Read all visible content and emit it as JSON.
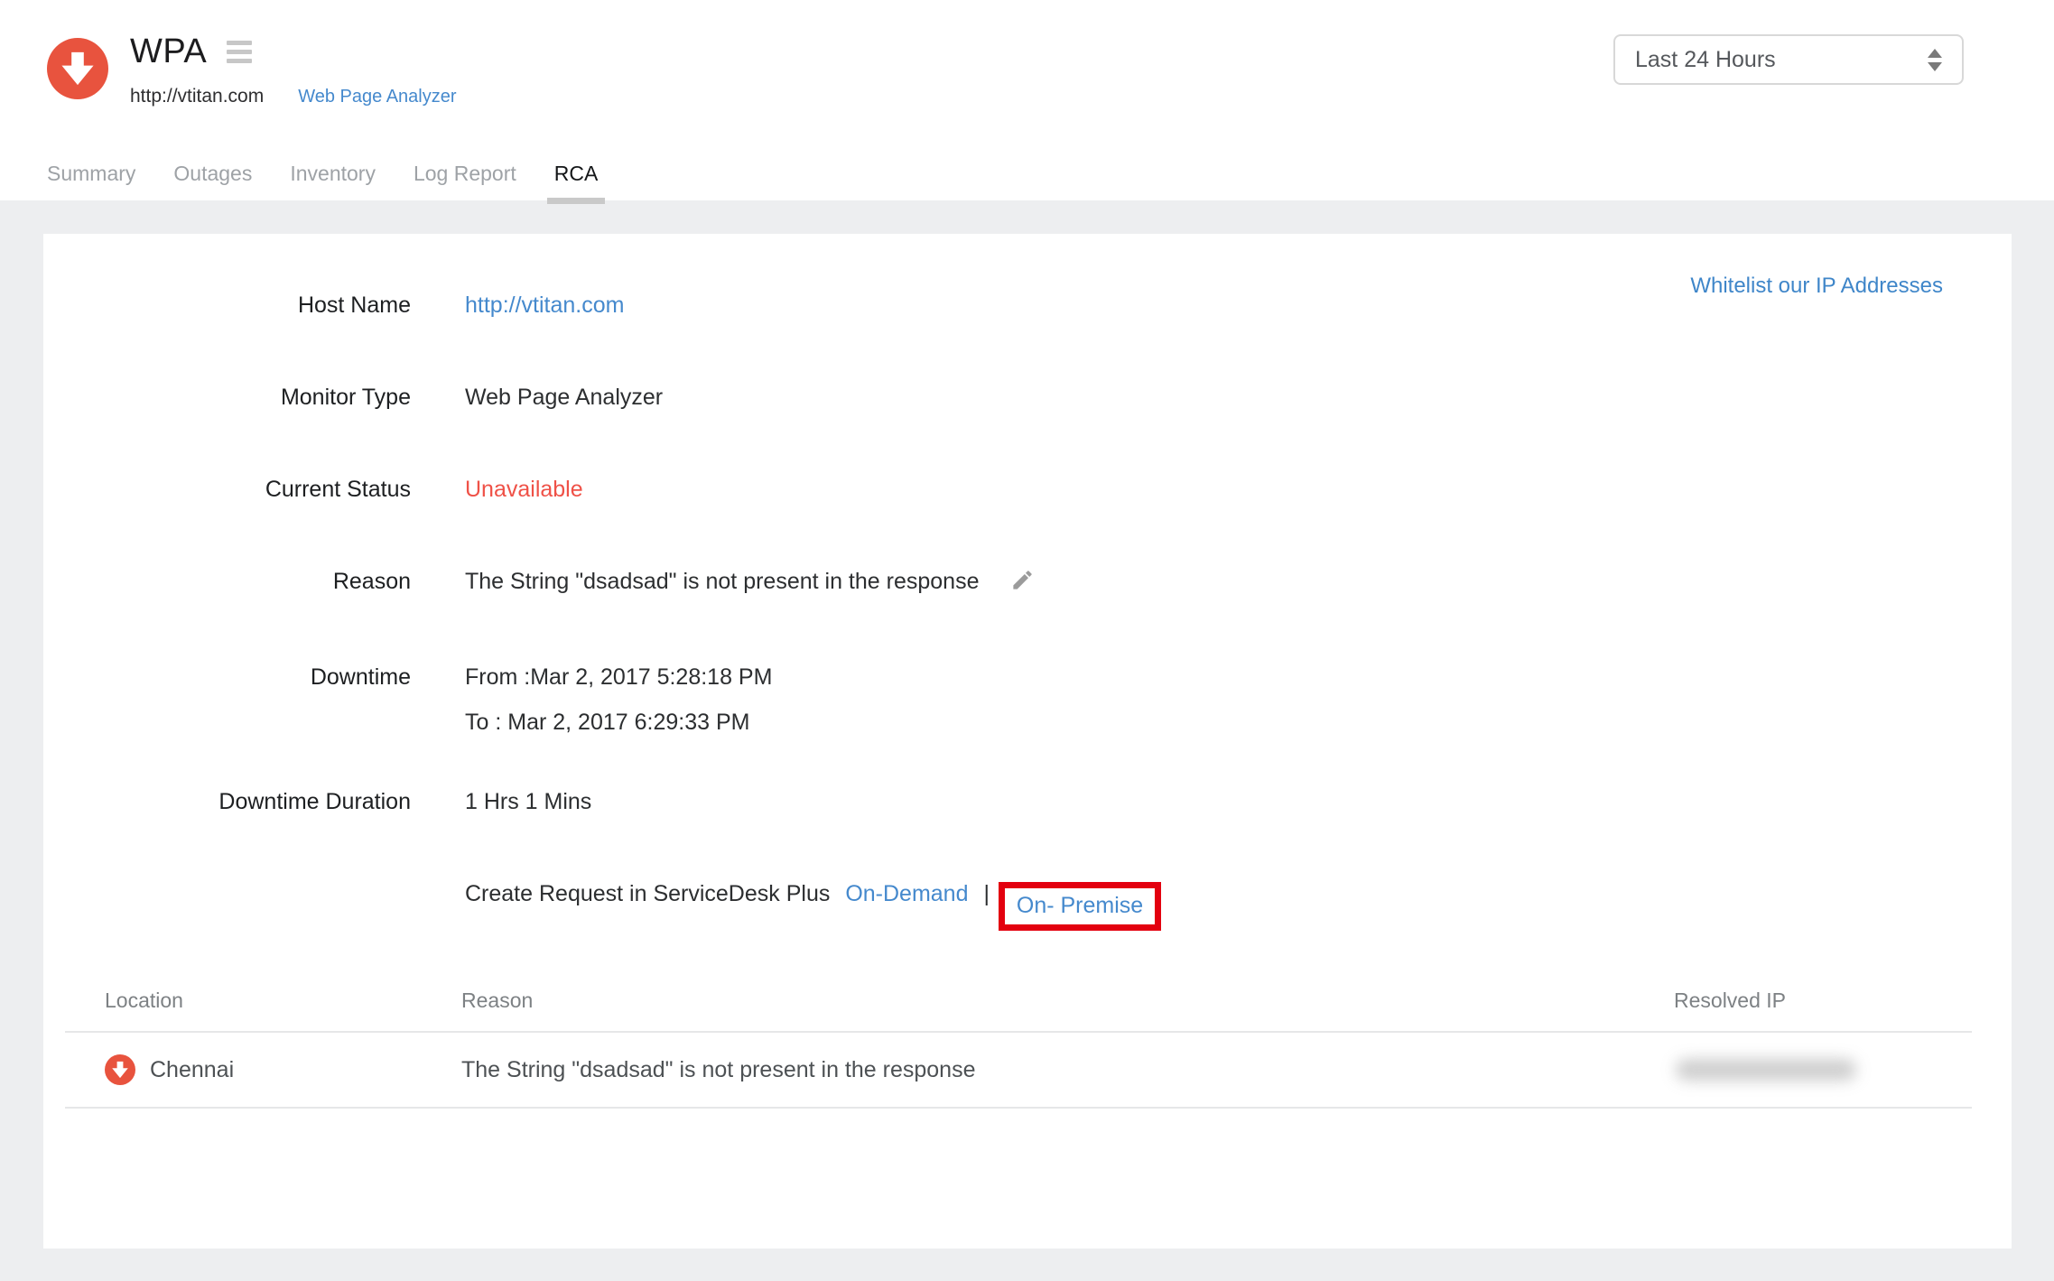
{
  "header": {
    "monitor_name": "WPA",
    "monitor_url": "http://vtitan.com",
    "monitor_type": "Web Page Analyzer",
    "tabs": [
      {
        "label": "Summary",
        "active": false
      },
      {
        "label": "Outages",
        "active": false
      },
      {
        "label": "Inventory",
        "active": false
      },
      {
        "label": "Log Report",
        "active": false
      },
      {
        "label": "RCA",
        "active": true
      }
    ],
    "time_range": "Last 24 Hours"
  },
  "rca": {
    "whitelist_link": "Whitelist our IP Addresses",
    "fields": {
      "host_name": {
        "label": "Host Name",
        "value": "http://vtitan.com"
      },
      "monitor_type": {
        "label": "Monitor Type",
        "value": "Web Page Analyzer"
      },
      "current_status": {
        "label": "Current Status",
        "value": "Unavailable"
      },
      "reason": {
        "label": "Reason",
        "value": "The String \"dsadsad\" is not present in the response"
      },
      "downtime": {
        "label": "Downtime",
        "from": "From :Mar 2, 2017 5:28:18 PM",
        "to": "To : Mar 2, 2017 6:29:33 PM"
      },
      "downtime_duration": {
        "label": "Downtime Duration",
        "value": "1 Hrs 1 Mins"
      }
    },
    "servicedesk": {
      "text": "Create Request in ServiceDesk Plus",
      "on_demand_link": "On-Demand",
      "separator": "|",
      "on_premise_link": "On- Premise",
      "on_premise_highlighted": true
    },
    "table": {
      "headers": {
        "location": "Location",
        "reason": "Reason",
        "resolved_ip": "Resolved IP"
      },
      "rows": [
        {
          "location": "Chennai",
          "status": "down",
          "reason": "The String \"dsadsad\" is not present in the response",
          "resolved_ip_redacted": true
        }
      ]
    }
  },
  "colors": {
    "status_down_red": "#e8533e",
    "unavailable_text_red": "#ef5147",
    "link_blue": "#4589cd",
    "annotation_box_red": "#e3000f",
    "page_background": "#edeef0",
    "active_tab_underline": "#c9c9c9"
  }
}
